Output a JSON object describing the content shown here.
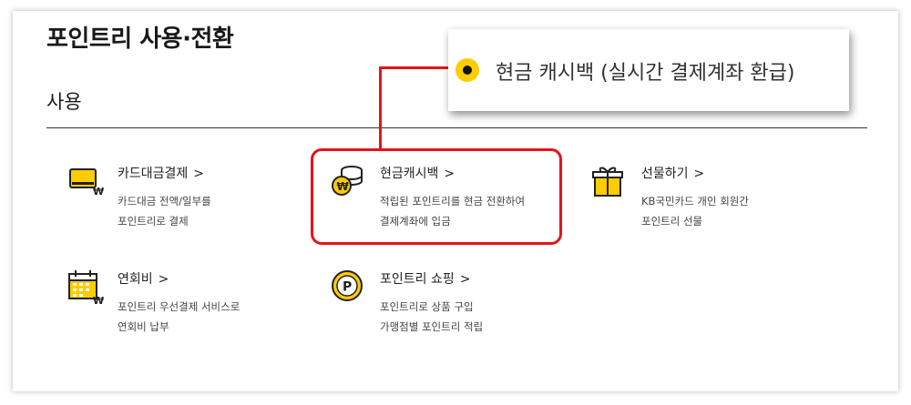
{
  "page": {
    "title": "포인트리 사용·전환",
    "section": "사용"
  },
  "items": [
    {
      "title": "카드대금결제",
      "chevron": ">",
      "desc": [
        "카드대금 전액/일부를",
        "포인트리로 결제"
      ],
      "icon": "card-payment-icon"
    },
    {
      "title": "현금캐시백",
      "chevron": ">",
      "desc": [
        "적립된 포인트리를 현금 전환하여",
        "결제계좌에 입금"
      ],
      "icon": "coin-stack-won-icon"
    },
    {
      "title": "선물하기",
      "chevron": ">",
      "desc": [
        "KB국민카드 개인 회원간",
        "포인트리 선물"
      ],
      "icon": "gift-icon"
    },
    {
      "title": "연회비",
      "chevron": ">",
      "desc": [
        "포인트리 우선결제 서비스로",
        "연회비 납부"
      ],
      "icon": "calendar-won-icon"
    },
    {
      "title": "포인트리 쇼핑",
      "chevron": ">",
      "desc": [
        "포인트리로 상품 구입",
        "가맹점별 포인트리 적립"
      ],
      "icon": "point-p-icon"
    }
  ],
  "callout": {
    "label": "현금 캐시백 (실시간 결제계좌 환급)"
  },
  "colors": {
    "accent_yellow": "#ffcc00",
    "highlight_red": "#e3141b",
    "text_dark": "#222222"
  }
}
